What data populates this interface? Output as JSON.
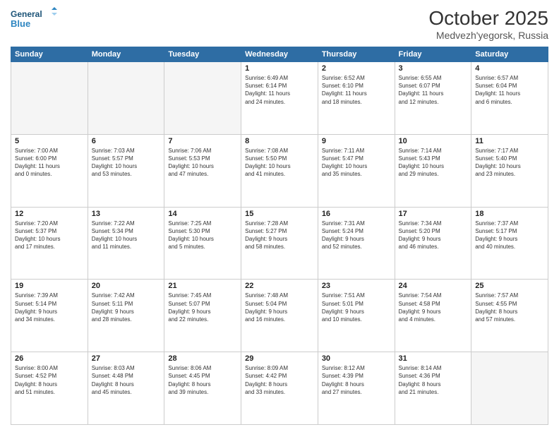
{
  "header": {
    "logo_line1": "General",
    "logo_line2": "Blue",
    "month": "October 2025",
    "location": "Medvezh'yegorsk, Russia"
  },
  "weekdays": [
    "Sunday",
    "Monday",
    "Tuesday",
    "Wednesday",
    "Thursday",
    "Friday",
    "Saturday"
  ],
  "weeks": [
    [
      {
        "day": "",
        "info": ""
      },
      {
        "day": "",
        "info": ""
      },
      {
        "day": "",
        "info": ""
      },
      {
        "day": "1",
        "info": "Sunrise: 6:49 AM\nSunset: 6:14 PM\nDaylight: 11 hours\nand 24 minutes."
      },
      {
        "day": "2",
        "info": "Sunrise: 6:52 AM\nSunset: 6:10 PM\nDaylight: 11 hours\nand 18 minutes."
      },
      {
        "day": "3",
        "info": "Sunrise: 6:55 AM\nSunset: 6:07 PM\nDaylight: 11 hours\nand 12 minutes."
      },
      {
        "day": "4",
        "info": "Sunrise: 6:57 AM\nSunset: 6:04 PM\nDaylight: 11 hours\nand 6 minutes."
      }
    ],
    [
      {
        "day": "5",
        "info": "Sunrise: 7:00 AM\nSunset: 6:00 PM\nDaylight: 11 hours\nand 0 minutes."
      },
      {
        "day": "6",
        "info": "Sunrise: 7:03 AM\nSunset: 5:57 PM\nDaylight: 10 hours\nand 53 minutes."
      },
      {
        "day": "7",
        "info": "Sunrise: 7:06 AM\nSunset: 5:53 PM\nDaylight: 10 hours\nand 47 minutes."
      },
      {
        "day": "8",
        "info": "Sunrise: 7:08 AM\nSunset: 5:50 PM\nDaylight: 10 hours\nand 41 minutes."
      },
      {
        "day": "9",
        "info": "Sunrise: 7:11 AM\nSunset: 5:47 PM\nDaylight: 10 hours\nand 35 minutes."
      },
      {
        "day": "10",
        "info": "Sunrise: 7:14 AM\nSunset: 5:43 PM\nDaylight: 10 hours\nand 29 minutes."
      },
      {
        "day": "11",
        "info": "Sunrise: 7:17 AM\nSunset: 5:40 PM\nDaylight: 10 hours\nand 23 minutes."
      }
    ],
    [
      {
        "day": "12",
        "info": "Sunrise: 7:20 AM\nSunset: 5:37 PM\nDaylight: 10 hours\nand 17 minutes."
      },
      {
        "day": "13",
        "info": "Sunrise: 7:22 AM\nSunset: 5:34 PM\nDaylight: 10 hours\nand 11 minutes."
      },
      {
        "day": "14",
        "info": "Sunrise: 7:25 AM\nSunset: 5:30 PM\nDaylight: 10 hours\nand 5 minutes."
      },
      {
        "day": "15",
        "info": "Sunrise: 7:28 AM\nSunset: 5:27 PM\nDaylight: 9 hours\nand 58 minutes."
      },
      {
        "day": "16",
        "info": "Sunrise: 7:31 AM\nSunset: 5:24 PM\nDaylight: 9 hours\nand 52 minutes."
      },
      {
        "day": "17",
        "info": "Sunrise: 7:34 AM\nSunset: 5:20 PM\nDaylight: 9 hours\nand 46 minutes."
      },
      {
        "day": "18",
        "info": "Sunrise: 7:37 AM\nSunset: 5:17 PM\nDaylight: 9 hours\nand 40 minutes."
      }
    ],
    [
      {
        "day": "19",
        "info": "Sunrise: 7:39 AM\nSunset: 5:14 PM\nDaylight: 9 hours\nand 34 minutes."
      },
      {
        "day": "20",
        "info": "Sunrise: 7:42 AM\nSunset: 5:11 PM\nDaylight: 9 hours\nand 28 minutes."
      },
      {
        "day": "21",
        "info": "Sunrise: 7:45 AM\nSunset: 5:07 PM\nDaylight: 9 hours\nand 22 minutes."
      },
      {
        "day": "22",
        "info": "Sunrise: 7:48 AM\nSunset: 5:04 PM\nDaylight: 9 hours\nand 16 minutes."
      },
      {
        "day": "23",
        "info": "Sunrise: 7:51 AM\nSunset: 5:01 PM\nDaylight: 9 hours\nand 10 minutes."
      },
      {
        "day": "24",
        "info": "Sunrise: 7:54 AM\nSunset: 4:58 PM\nDaylight: 9 hours\nand 4 minutes."
      },
      {
        "day": "25",
        "info": "Sunrise: 7:57 AM\nSunset: 4:55 PM\nDaylight: 8 hours\nand 57 minutes."
      }
    ],
    [
      {
        "day": "26",
        "info": "Sunrise: 8:00 AM\nSunset: 4:52 PM\nDaylight: 8 hours\nand 51 minutes."
      },
      {
        "day": "27",
        "info": "Sunrise: 8:03 AM\nSunset: 4:48 PM\nDaylight: 8 hours\nand 45 minutes."
      },
      {
        "day": "28",
        "info": "Sunrise: 8:06 AM\nSunset: 4:45 PM\nDaylight: 8 hours\nand 39 minutes."
      },
      {
        "day": "29",
        "info": "Sunrise: 8:09 AM\nSunset: 4:42 PM\nDaylight: 8 hours\nand 33 minutes."
      },
      {
        "day": "30",
        "info": "Sunrise: 8:12 AM\nSunset: 4:39 PM\nDaylight: 8 hours\nand 27 minutes."
      },
      {
        "day": "31",
        "info": "Sunrise: 8:14 AM\nSunset: 4:36 PM\nDaylight: 8 hours\nand 21 minutes."
      },
      {
        "day": "",
        "info": ""
      }
    ]
  ]
}
